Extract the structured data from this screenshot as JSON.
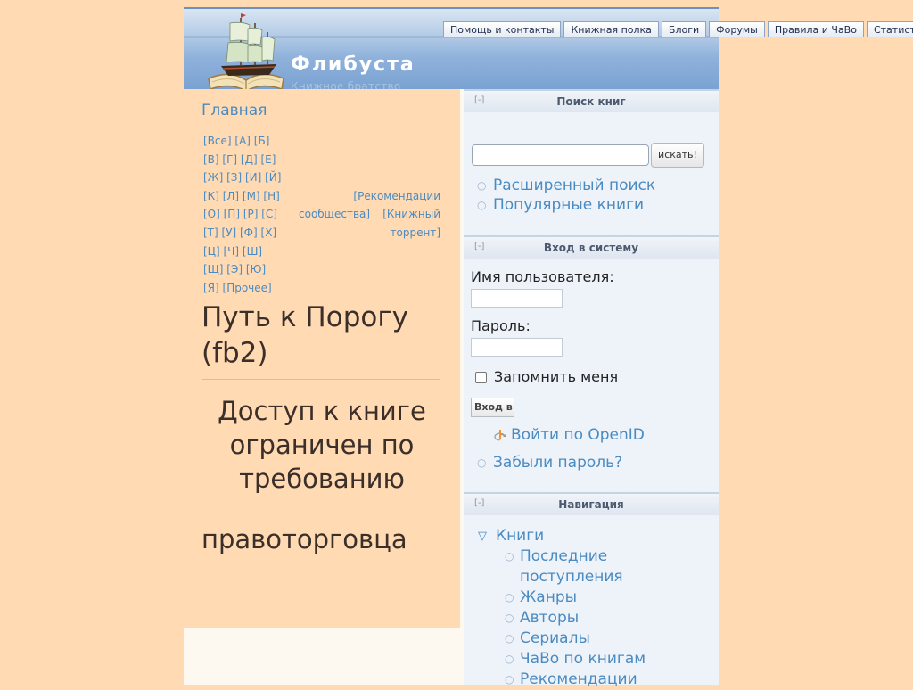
{
  "header": {
    "site_name": "Флибуста",
    "site_slogan": "Книжное братство"
  },
  "tabs": [
    {
      "label": "Помощь и контакты"
    },
    {
      "label": "Книжная полка"
    },
    {
      "label": "Блоги"
    },
    {
      "label": "Форумы"
    },
    {
      "label": "Правила и ЧаВо"
    },
    {
      "label": "Статистика"
    }
  ],
  "left": {
    "home_link": "Главная",
    "alphabet_rows": [
      {
        "left": "[Все] [А] [Б]",
        "mid": "",
        "right": ""
      },
      {
        "left": "[В] [Г] [Д] [Е]",
        "mid": "",
        "right": ""
      },
      {
        "left": "[Ж] [З] [И] [Й]",
        "mid": "",
        "right": ""
      },
      {
        "left": "[К] [Л] [М] [Н]",
        "mid": "",
        "right": "[Рекомендации"
      },
      {
        "left": "[О] [П] [Р] [С]",
        "mid": "сообщества]",
        "right": "[Книжный"
      },
      {
        "left": "[Т] [У] [Ф] [Х]",
        "mid": "",
        "right": "торрент]"
      },
      {
        "left": "[Ц] [Ч] [Ш]",
        "mid": "",
        "right": ""
      },
      {
        "left": "[Щ] [Э] [Ю]",
        "mid": "",
        "right": ""
      },
      {
        "left": "[Я] [Прочее]",
        "mid": "",
        "right": ""
      }
    ],
    "book_title": "Путь к Порогу (fb2)",
    "restricted_msg": "Доступ к книге ограничен по требованию",
    "restricted_msg_2": "правоторговца"
  },
  "sidebar": {
    "search_block": {
      "toggle": "[-]",
      "title": "Поиск книг",
      "input_value": "",
      "button": "искать!",
      "links": [
        "Расширенный поиск",
        "Популярные книги"
      ]
    },
    "login_block": {
      "toggle": "[-]",
      "title": "Вход в систему",
      "username_label": "Имя пользователя:",
      "password_label": "Пароль:",
      "remember_label": "Запомнить меня",
      "login_button": "Вход в систему",
      "openid_link": "Войти по OpenID",
      "forgot_link": "Забыли пароль?"
    },
    "nav_block": {
      "toggle": "[-]",
      "title": "Навигация",
      "root": "Книги",
      "items": [
        "Последние поступления",
        "Жанры",
        "Авторы",
        "Сериалы",
        "ЧаВо по книгам",
        "Рекомендации"
      ]
    }
  },
  "colors": {
    "background": "#ffdab3",
    "link": "#4a8bc2",
    "header_blue": "#7aa2d2",
    "sidebar_bg": "#eef3fa"
  }
}
